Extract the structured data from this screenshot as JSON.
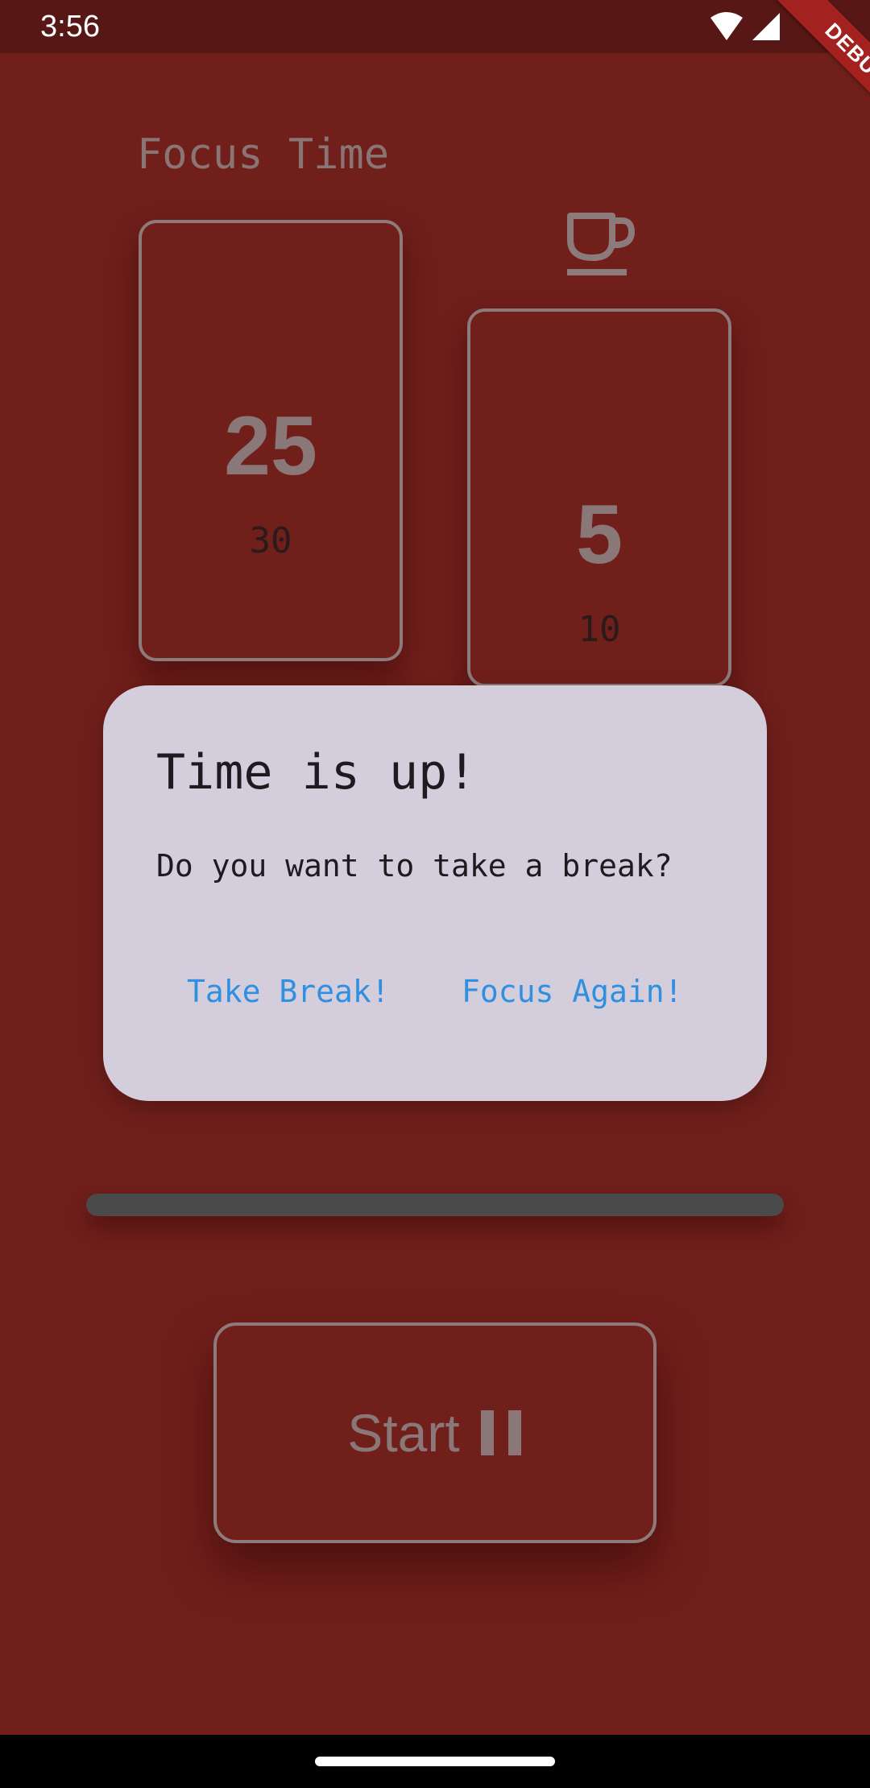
{
  "status_bar": {
    "time": "3:56",
    "debug_label": "DEBUG"
  },
  "timer": {
    "focus_label": "Focus Time",
    "focus_card": {
      "minutes": "25",
      "next": "30"
    },
    "break_card": {
      "minutes": "5",
      "next": "10",
      "icon": "coffee-cup-icon"
    },
    "progress": 0
  },
  "controls": {
    "start_label": "Start",
    "pause_icon": "pause-icon"
  },
  "dialog": {
    "title": "Time is up!",
    "message": "Do you want to take a break?",
    "take_break_label": "Take Break!",
    "focus_again_label": "Focus Again!"
  },
  "colors": {
    "background": "#711f1b",
    "status_bar": "#561715",
    "dialog_surface": "#d4cedc",
    "dialog_action": "#2f8fe0",
    "card_border": "#8d7a7a",
    "progress_track": "#4a4a4a"
  }
}
